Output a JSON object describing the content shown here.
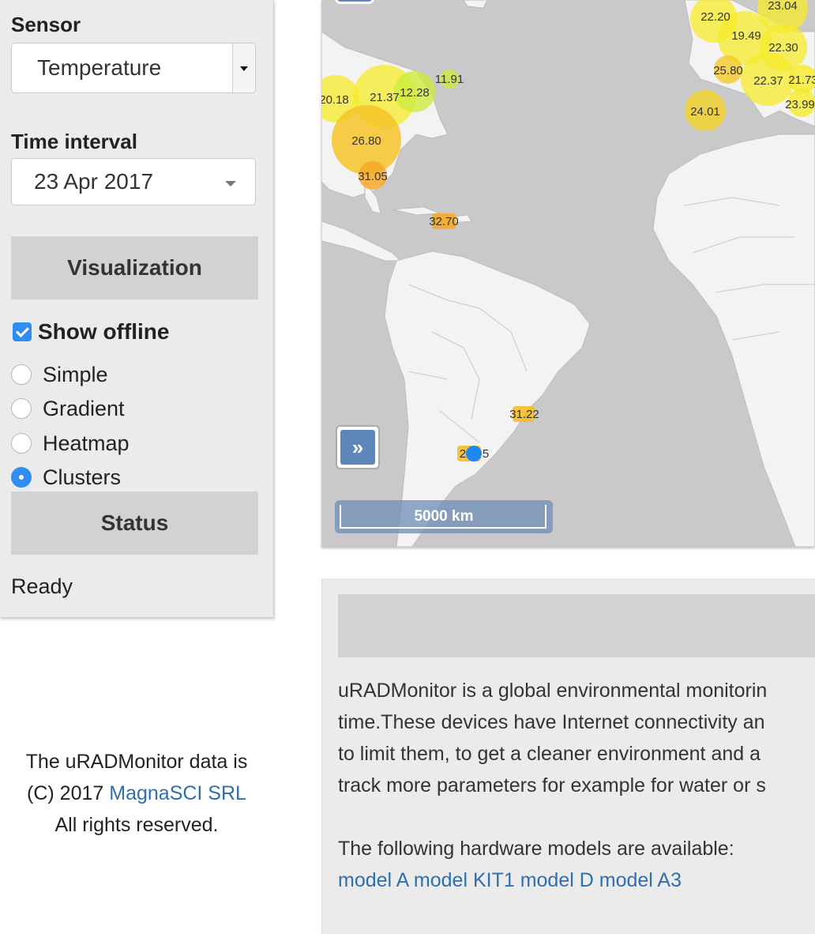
{
  "sidebar": {
    "sensor_label": "Sensor",
    "sensor_value": "Temperature",
    "time_label": "Time interval",
    "time_value": "23 Apr 2017",
    "visualization_button": "Visualization",
    "show_offline_label": "Show offline",
    "show_offline_checked": true,
    "modes": [
      {
        "label": "Simple",
        "selected": false
      },
      {
        "label": "Gradient",
        "selected": false
      },
      {
        "label": "Heatmap",
        "selected": false
      },
      {
        "label": "Clusters",
        "selected": true
      }
    ],
    "status_button": "Status",
    "status_text": "Ready"
  },
  "footer": {
    "line1": "The uRADMonitor data is",
    "line2_prefix": "(C) 2017 ",
    "line2_link": "MagnaSCI SRL",
    "line3": "All rights reserved."
  },
  "map": {
    "expand_icon_glyph": "»",
    "scale_label": "5000 km",
    "cluster_values": [
      "22.20",
      "23.04",
      "19.49",
      "22.30",
      "25.80",
      "22.37",
      "21.73",
      "23.99",
      "24.01",
      "20.18",
      "21.37",
      "12.28",
      "11.91",
      "26.80",
      "31.05",
      "32.70",
      "31.22",
      "2",
      "5"
    ]
  },
  "info": {
    "paragraph_lines": [
      "uRADMonitor is a global environmental monitorin",
      "time.These devices have Internet connectivity an",
      "to limit them, to get a cleaner environment and a",
      "track more parameters for example for water or s"
    ],
    "models_intro": "The following hardware models are available:",
    "models": [
      "model A",
      "model KIT1",
      "model D",
      "model A3"
    ]
  },
  "colors": {
    "accent": "#2f8ef0",
    "link": "#2f6fb0",
    "map_land": "#f3f3f3",
    "map_water": "#c9c9c9"
  }
}
